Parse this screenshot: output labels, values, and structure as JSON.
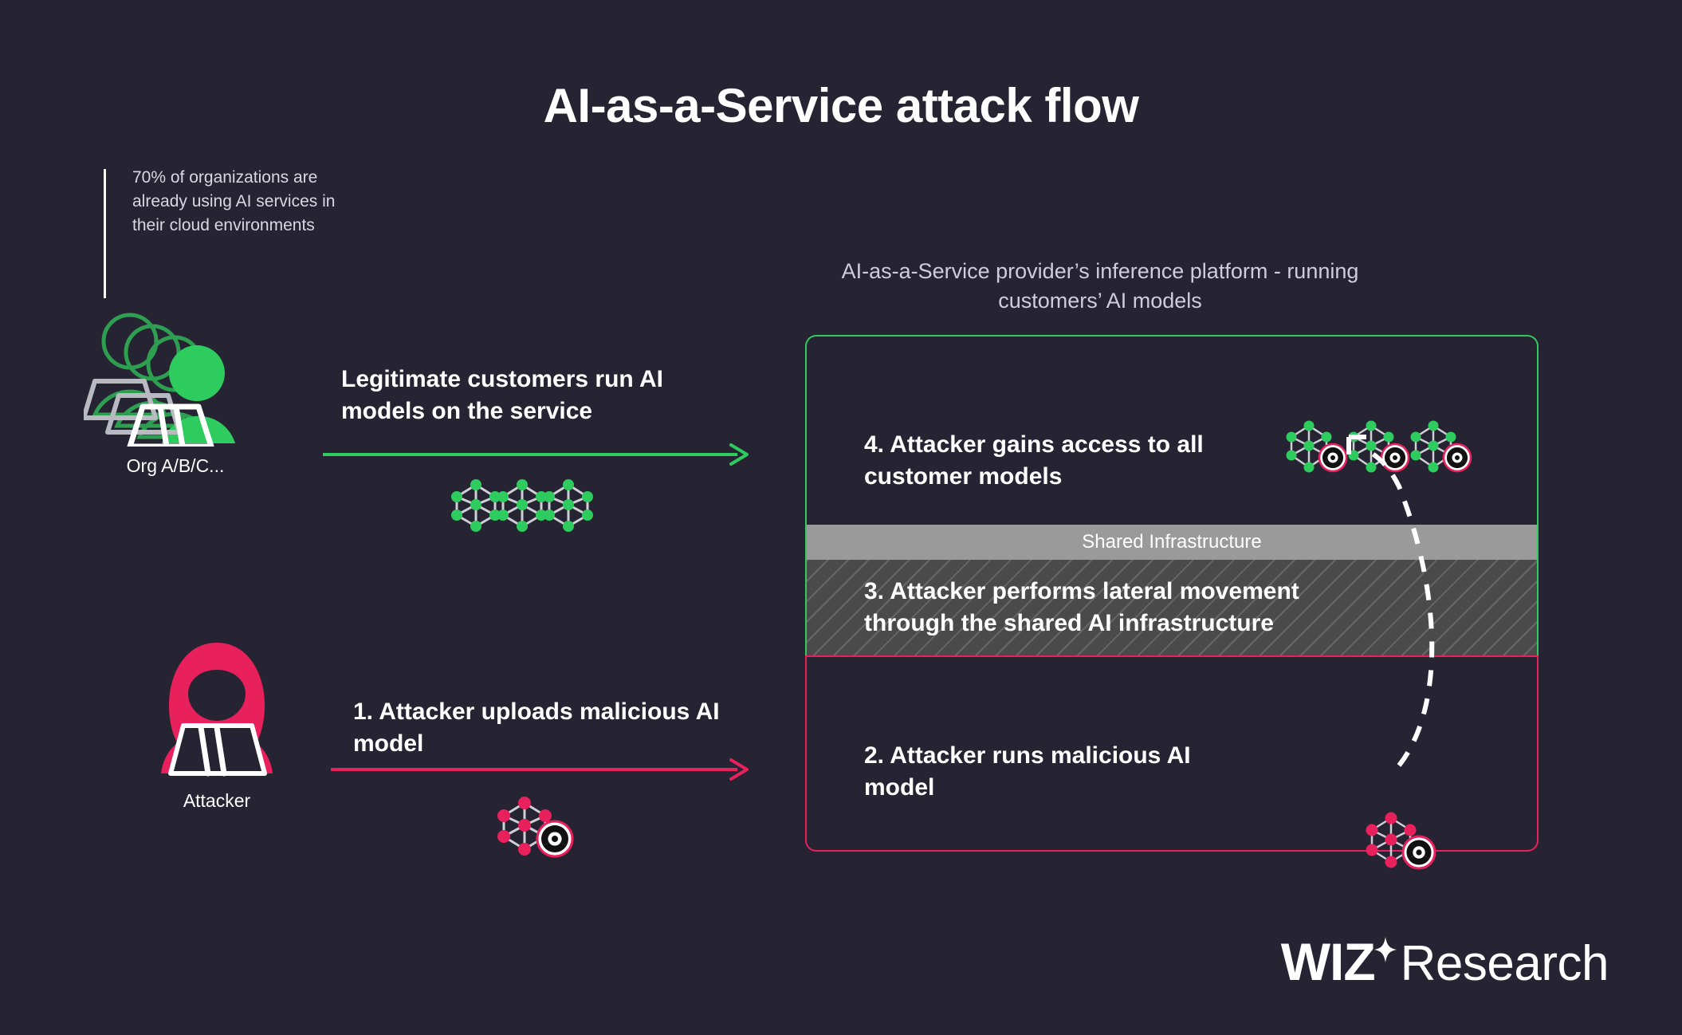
{
  "title": "AI-as-a-Service attack flow",
  "stat_callout": {
    "text": "70% of organizations are already using AI services in their cloud environments"
  },
  "actors": {
    "org": {
      "label": "Org A/B/C...",
      "icon": "people-stack-icon",
      "color": "#2ECC5E"
    },
    "attacker": {
      "label": "Attacker",
      "icon": "hooded-attacker-icon",
      "color": "#E8205C"
    }
  },
  "flows": [
    {
      "id": "legitimate",
      "label": "Legitimate customers run AI models on the service",
      "arrow_color": "#2ECC5E",
      "model_count": 3,
      "model_type": "clean-model-icon"
    },
    {
      "id": "malicious-upload",
      "label": "1. Attacker uploads malicious AI model",
      "arrow_color": "#E8205C",
      "model_count": 1,
      "model_type": "malicious-model-icon"
    }
  ],
  "platform": {
    "heading": "AI-as-a-Service provider’s inference platform - running customers’ AI models",
    "zones": {
      "top": {
        "text": "4. Attacker gains access to all customer models",
        "border_color": "#2ECC5E",
        "model_count": 3,
        "model_type": "compromised-model-icon"
      },
      "shared_label": {
        "text": "Shared Infrastructure",
        "background": "#9a9a9a"
      },
      "hatch": {
        "text": "3. Attacker performs lateral movement through the shared AI infrastructure",
        "background": "#4a4a4a"
      },
      "bottom": {
        "text": "2. Attacker runs malicious AI model",
        "border_color": "#E8205C",
        "model_count": 1,
        "model_type": "malicious-model-icon"
      }
    },
    "lateral_arrow": {
      "style": "dashed",
      "color": "#ffffff"
    }
  },
  "logo": {
    "brand": "WIZ",
    "suffix": "Research"
  },
  "colors": {
    "background": "#262433",
    "green": "#2ECC5E",
    "pink": "#E8205C",
    "muted_text": "#cfcddb",
    "edge_gray": "#cfcfd6"
  }
}
